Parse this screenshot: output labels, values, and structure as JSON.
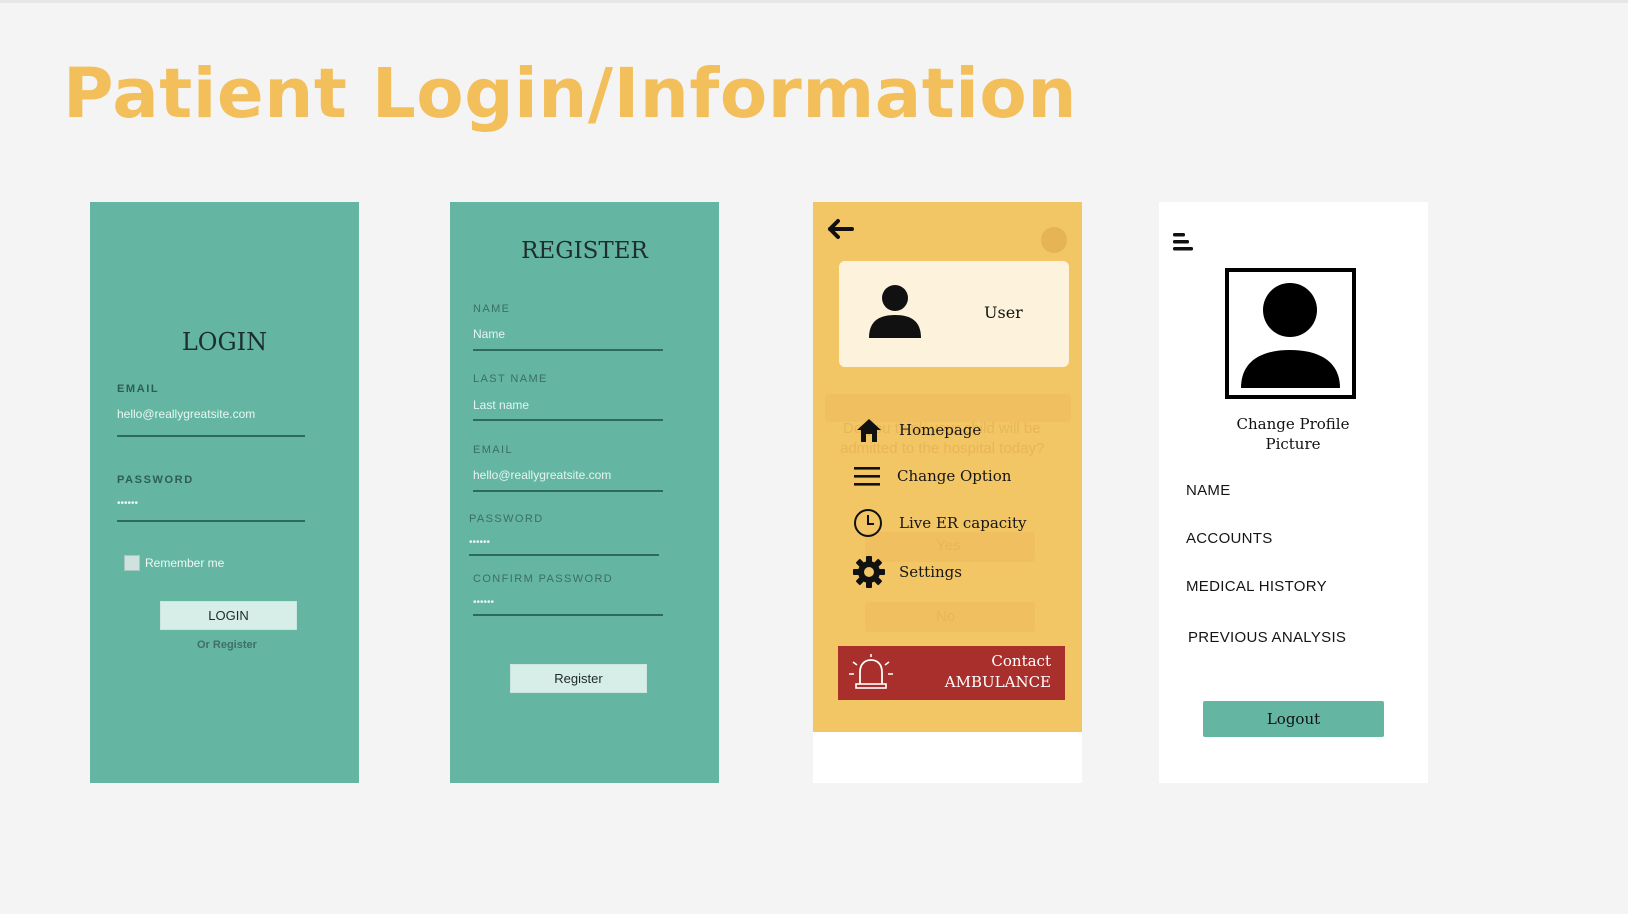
{
  "page": {
    "title": "Patient Login/Information"
  },
  "login": {
    "title": "LOGIN",
    "email_label": "EMAIL",
    "email_value": "hello@reallygreatsite.com",
    "password_label": "PASSWORD",
    "password_value": "••••••",
    "remember_label": "Remember me",
    "login_button": "LOGIN",
    "register_link": "Or Register"
  },
  "register": {
    "title": "REGISTER",
    "name_label": "NAME",
    "name_placeholder": "Name",
    "last_name_label": "LAST NAME",
    "last_name_placeholder": "Last name",
    "email_label": "EMAIL",
    "email_value": "hello@reallygreatsite.com",
    "password_label": "PASSWORD",
    "password_value": "••••••",
    "confirm_label": "CONFIRM PASSWORD",
    "confirm_value": "••••••",
    "register_button": "Register"
  },
  "menu": {
    "user_label": "User",
    "ghost_question_line1": "Do you think your child will be",
    "ghost_question_line2": "admitted to the hospital today?",
    "ghost_yes": "Yes",
    "ghost_no": "No",
    "items": [
      {
        "label": "Homepage",
        "icon": "home-icon"
      },
      {
        "label": "Change Option",
        "icon": "menu-lines-icon"
      },
      {
        "label": "Live ER capacity",
        "icon": "clock-icon"
      },
      {
        "label": "Settings",
        "icon": "gear-icon"
      }
    ],
    "ambulance_line1": "Contact",
    "ambulance_line2": "AMBULANCE"
  },
  "profile": {
    "change_picture": "Change Profile Picture",
    "items": [
      "NAME",
      "ACCOUNTS",
      "MEDICAL HISTORY",
      "PREVIOUS ANALYSIS"
    ],
    "logout_button": "Logout"
  },
  "colors": {
    "title": "#f3bf5b",
    "teal": "#64b6a3",
    "yellow": "#f2c565",
    "ambulance_red": "#a92f2c"
  }
}
